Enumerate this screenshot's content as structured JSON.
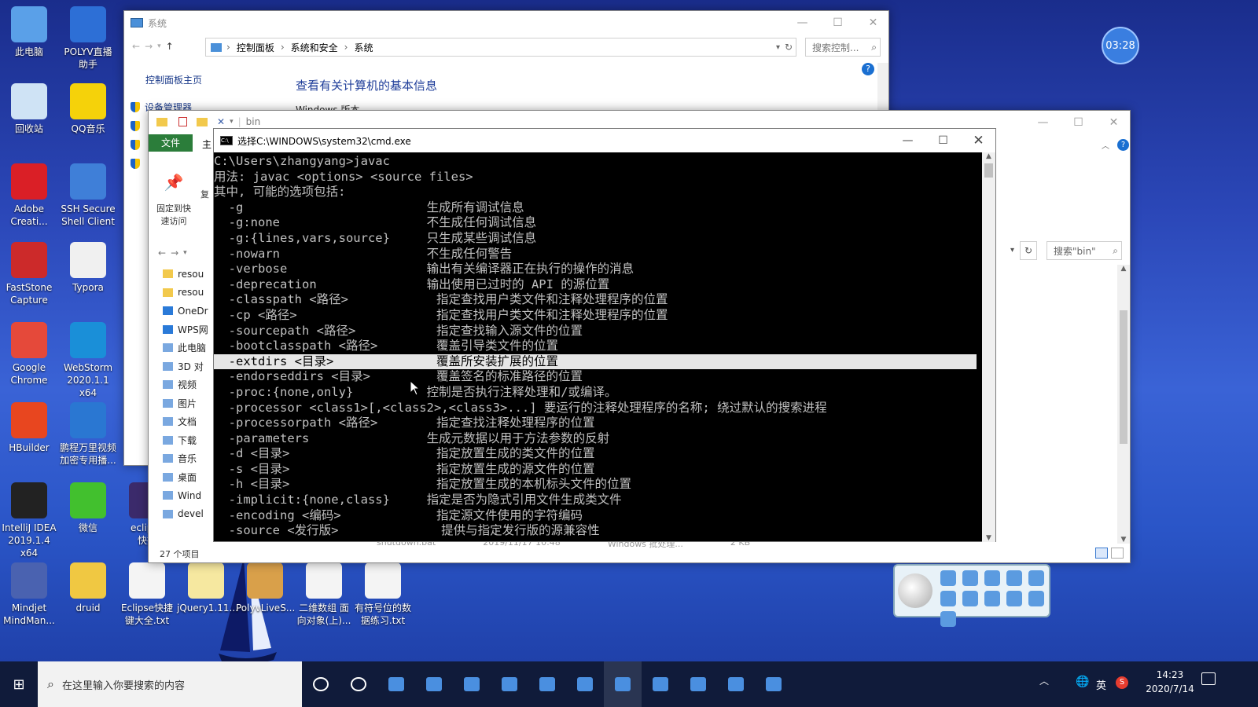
{
  "desktop_icons": [
    {
      "label": "此电脑",
      "name": "this-pc-icon",
      "col": 0,
      "row": 0
    },
    {
      "label": "POLYV直播\n助手",
      "name": "polyv-icon",
      "col": 1,
      "row": 0
    },
    {
      "label": "回收站",
      "name": "recycle-bin-icon",
      "col": 0,
      "row": 1
    },
    {
      "label": "QQ音乐",
      "name": "qq-music-icon",
      "col": 1,
      "row": 1
    },
    {
      "label": "Adobe\nCreati...",
      "name": "adobe-icon",
      "col": 0,
      "row": 2
    },
    {
      "label": "SSH Secure\nShell Client",
      "name": "ssh-icon",
      "col": 1,
      "row": 2
    },
    {
      "label": "FastStone\nCapture",
      "name": "faststone-icon",
      "col": 0,
      "row": 3
    },
    {
      "label": "Typora",
      "name": "typora-icon",
      "col": 1,
      "row": 3
    },
    {
      "label": "Google\nChrome",
      "name": "chrome-icon",
      "col": 0,
      "row": 4
    },
    {
      "label": "WebStorm\n2020.1.1 x64",
      "name": "webstorm-icon",
      "col": 1,
      "row": 4
    },
    {
      "label": "HBuilder",
      "name": "hbuilder-icon",
      "col": 0,
      "row": 5
    },
    {
      "label": "鹏程万里视频\n加密专用播...",
      "name": "video-player-icon",
      "col": 1,
      "row": 5
    },
    {
      "label": "IntelliJ IDEA\n2019.1.4 x64",
      "name": "intellij-icon",
      "col": 0,
      "row": 6
    },
    {
      "label": "微信",
      "name": "wechat-icon",
      "col": 1,
      "row": 6
    },
    {
      "label": "eclipse\n快捷",
      "name": "eclipse-icon",
      "col": 2,
      "row": 6
    },
    {
      "label": "Mindjet\nMindMan...",
      "name": "mindjet-icon",
      "col": 0,
      "row": 7
    },
    {
      "label": "druid",
      "name": "druid-icon",
      "col": 1,
      "row": 7
    },
    {
      "label": "Eclipse快捷\n键大全.txt",
      "name": "txt-file-icon",
      "col": 2,
      "row": 7
    },
    {
      "label": "jQuery1.11...",
      "name": "jquery-icon",
      "col": 3,
      "row": 7
    },
    {
      "label": "PolyvLiveS...",
      "name": "polyv-live-icon",
      "col": 4,
      "row": 7
    },
    {
      "label": "二维数组 面\n向对象(上)...",
      "name": "doc-file-icon",
      "col": 5,
      "row": 7
    },
    {
      "label": "有符号位的数\n据练习.txt",
      "name": "txt-file-icon-2",
      "col": 6,
      "row": 7
    }
  ],
  "clock_badge": "03:28",
  "system_window": {
    "title": "系统",
    "breadcrumb": [
      "控制面板",
      "系统和安全",
      "系统"
    ],
    "search_placeholder": "搜索控制...",
    "home_link": "控制面板主页",
    "device_manager": "设备管理器",
    "heading": "查看有关计算机的基本信息",
    "windows_edition": "Windows 版本"
  },
  "explorer_window": {
    "title": "bin",
    "ribbon_tab_file": "文件",
    "ribbon_tab_home": "主",
    "pin_label": "固定到快\n速访问",
    "copy_label": "复",
    "search_placeholder": "搜索\"bin\"",
    "nav_items": [
      "resou",
      "resou",
      "OneDr",
      "WPS网",
      "此电脑",
      "3D 对",
      "视频",
      "图片",
      "文档",
      "下载",
      "音乐",
      "桌面",
      "Wind",
      "devel"
    ],
    "status": "27 个项目",
    "file_row": "shutdown.bat",
    "file_date": "2019/11/17 10:48",
    "file_type": "Windows 批处理...",
    "file_size": "2 KB"
  },
  "cmd_window": {
    "title": "选择C:\\WINDOWS\\system32\\cmd.exe",
    "lines": [
      "C:\\Users\\zhangyang>javac",
      "用法: javac <options> <source files>",
      "其中, 可能的选项包括:",
      "  -g                         生成所有调试信息",
      "  -g:none                    不生成任何调试信息",
      "  -g:{lines,vars,source}     只生成某些调试信息",
      "  -nowarn                    不生成任何警告",
      "  -verbose                   输出有关编译器正在执行的操作的消息",
      "  -deprecation               输出使用已过时的 API 的源位置",
      "  -classpath <路径>            指定查找用户类文件和注释处理程序的位置",
      "  -cp <路径>                   指定查找用户类文件和注释处理程序的位置",
      "  -sourcepath <路径>           指定查找输入源文件的位置",
      "  -bootclasspath <路径>        覆盖引导类文件的位置",
      "  -extdirs <目录>              覆盖所安装扩展的位置",
      "  -endorseddirs <目录>         覆盖签名的标准路径的位置",
      "  -proc:{none,only}          控制是否执行注释处理和/或编译。",
      "  -processor <class1>[,<class2>,<class3>...] 要运行的注释处理程序的名称; 绕过默认的搜索进程",
      "  -processorpath <路径>        指定查找注释处理程序的位置",
      "  -parameters                生成元数据以用于方法参数的反射",
      "  -d <目录>                    指定放置生成的类文件的位置",
      "  -s <目录>                    指定放置生成的源文件的位置",
      "  -h <目录>                    指定放置生成的本机标头文件的位置",
      "  -implicit:{none,class}     指定是否为隐式引用文件生成类文件",
      "  -encoding <编码>             指定源文件使用的字符编码",
      "  -source <发行版>              提供与指定发行版的源兼容性"
    ],
    "highlight_index": 13
  },
  "taskbar": {
    "search_placeholder": "在这里输入你要搜索的内容",
    "ime": "英",
    "time": "14:23",
    "date": "2020/7/14"
  }
}
